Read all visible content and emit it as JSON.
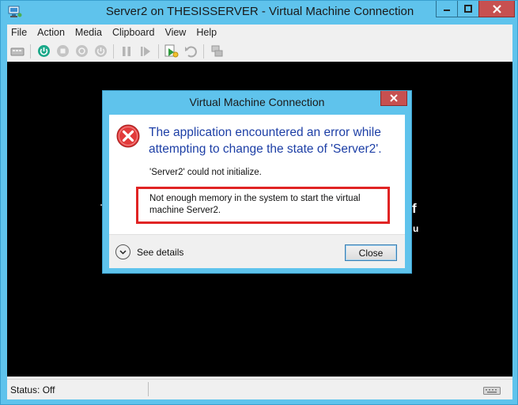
{
  "window": {
    "title": "Server2 on THESISSERVER - Virtual Machine Connection",
    "icons": {
      "app": "vm-connection-icon",
      "minimize": "minimize-icon",
      "maximize": "maximize-icon",
      "close": "close-icon"
    }
  },
  "menu": [
    "File",
    "Action",
    "Media",
    "Clipboard",
    "View",
    "Help"
  ],
  "toolbar": {
    "icons": [
      "ctrl-alt-del-icon",
      "start-icon",
      "turn-off-icon",
      "shut-down-icon",
      "power-icon",
      "pause-icon",
      "reset-icon",
      "checkpoint-icon",
      "revert-icon",
      "enhanced-session-icon"
    ]
  },
  "vm_screen": {
    "fragments": [
      "T",
      "f",
      "u"
    ]
  },
  "dialog": {
    "title": "Virtual Machine Connection",
    "main_instruction": "The application encountered an error while attempting to change the state of 'Server2'.",
    "content_line": "'Server2' could not initialize.",
    "highlight_text": "Not enough memory in the system to start the virtual machine Server2.",
    "see_details_label": "See details",
    "close_button_label": "Close",
    "icons": {
      "error": "error-icon",
      "expand": "chevron-down-icon",
      "close": "close-icon"
    },
    "colors": {
      "instruction": "#1d3fa6",
      "highlight_border": "#e02424"
    }
  },
  "statusbar": {
    "text": "Status: Off",
    "icon": "keyboard-icon"
  },
  "colors": {
    "chrome": "#5fc3ec",
    "close_button": "#c75050",
    "vm_background": "#000000"
  }
}
